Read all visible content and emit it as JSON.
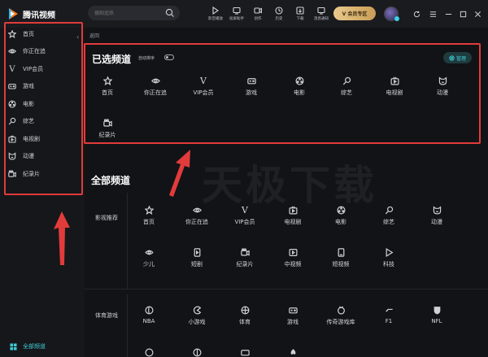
{
  "app": {
    "name": "腾讯视频"
  },
  "search": {
    "placeholder": "搜剧追热"
  },
  "toolbar": [
    {
      "label": "影音播放",
      "icon": "play-icon"
    },
    {
      "label": "投屏助手",
      "icon": "cast-icon"
    },
    {
      "label": "创作",
      "icon": "create-icon"
    },
    {
      "label": "历史",
      "icon": "history-icon"
    },
    {
      "label": "下载",
      "icon": "download-icon"
    },
    {
      "label": "消息通知",
      "icon": "message-icon"
    }
  ],
  "vip_button": {
    "label": "V 会员专区"
  },
  "window_controls": [
    "refresh",
    "menu",
    "minimize",
    "maximize",
    "close"
  ],
  "sidebar": {
    "items": [
      {
        "label": "首页",
        "icon": "star-icon"
      },
      {
        "label": "你正在追",
        "icon": "eye-icon"
      },
      {
        "label": "VIP会员",
        "icon": "vip-v-icon"
      },
      {
        "label": "游戏",
        "icon": "gamepad-icon"
      },
      {
        "label": "电影",
        "icon": "film-reel-icon"
      },
      {
        "label": "综艺",
        "icon": "microphone-icon"
      },
      {
        "label": "电视剧",
        "icon": "tv-icon"
      },
      {
        "label": "动漫",
        "icon": "cat-face-icon"
      },
      {
        "label": "纪录片",
        "icon": "camera-icon"
      }
    ],
    "footer_label": "全部频道"
  },
  "main": {
    "back_label": "返回",
    "selected_title": "已选频道",
    "auto_sort_label": "自动排序",
    "manage_label": "管理",
    "selected_channels": [
      {
        "label": "首页",
        "icon": "star-icon"
      },
      {
        "label": "你正在追",
        "icon": "eye-icon"
      },
      {
        "label": "VIP会员",
        "icon": "vip-v-icon"
      },
      {
        "label": "游戏",
        "icon": "gamepad-icon"
      },
      {
        "label": "电影",
        "icon": "film-reel-icon"
      },
      {
        "label": "综艺",
        "icon": "microphone-icon"
      },
      {
        "label": "电视剧",
        "icon": "tv-icon"
      },
      {
        "label": "动漫",
        "icon": "cat-face-icon"
      },
      {
        "label": "纪录片",
        "icon": "camera-icon"
      }
    ],
    "all_title": "全部频道",
    "categories": [
      {
        "name": "影视推荐",
        "rows": [
          [
            {
              "label": "首页",
              "icon": "star-icon"
            },
            {
              "label": "你正在追",
              "icon": "eye-icon"
            },
            {
              "label": "VIP会员",
              "icon": "vip-v-icon"
            },
            {
              "label": "电视剧",
              "icon": "tv-icon"
            },
            {
              "label": "电影",
              "icon": "film-reel-icon"
            },
            {
              "label": "综艺",
              "icon": "microphone-icon"
            },
            {
              "label": "动漫",
              "icon": "cat-face-icon"
            }
          ],
          [
            {
              "label": "少儿",
              "icon": "kid-icon"
            },
            {
              "label": "短剧",
              "icon": "short-play-icon"
            },
            {
              "label": "纪录片",
              "icon": "camera-icon"
            },
            {
              "label": "中视频",
              "icon": "video-icon"
            },
            {
              "label": "短视频",
              "icon": "short-video-icon"
            },
            {
              "label": "科技",
              "icon": "tech-icon"
            }
          ]
        ]
      },
      {
        "name": "体育游戏",
        "rows": [
          [
            {
              "label": "NBA",
              "icon": "basketball-icon"
            },
            {
              "label": "小游戏",
              "icon": "pacman-icon"
            },
            {
              "label": "体育",
              "icon": "sports-ball-icon"
            },
            {
              "label": "游戏",
              "icon": "gamepad-icon"
            },
            {
              "label": "传奇游戏库",
              "icon": "legend-icon"
            },
            {
              "label": "F1",
              "icon": "f1-icon"
            },
            {
              "label": "NFL",
              "icon": "nfl-shield-icon"
            }
          ]
        ]
      }
    ]
  },
  "watermark": "天极下载",
  "colors": {
    "accent": "#3fcbd6",
    "highlight_box": "#e23b3b",
    "vip_gold": "#d9b370",
    "background": "#121316"
  }
}
